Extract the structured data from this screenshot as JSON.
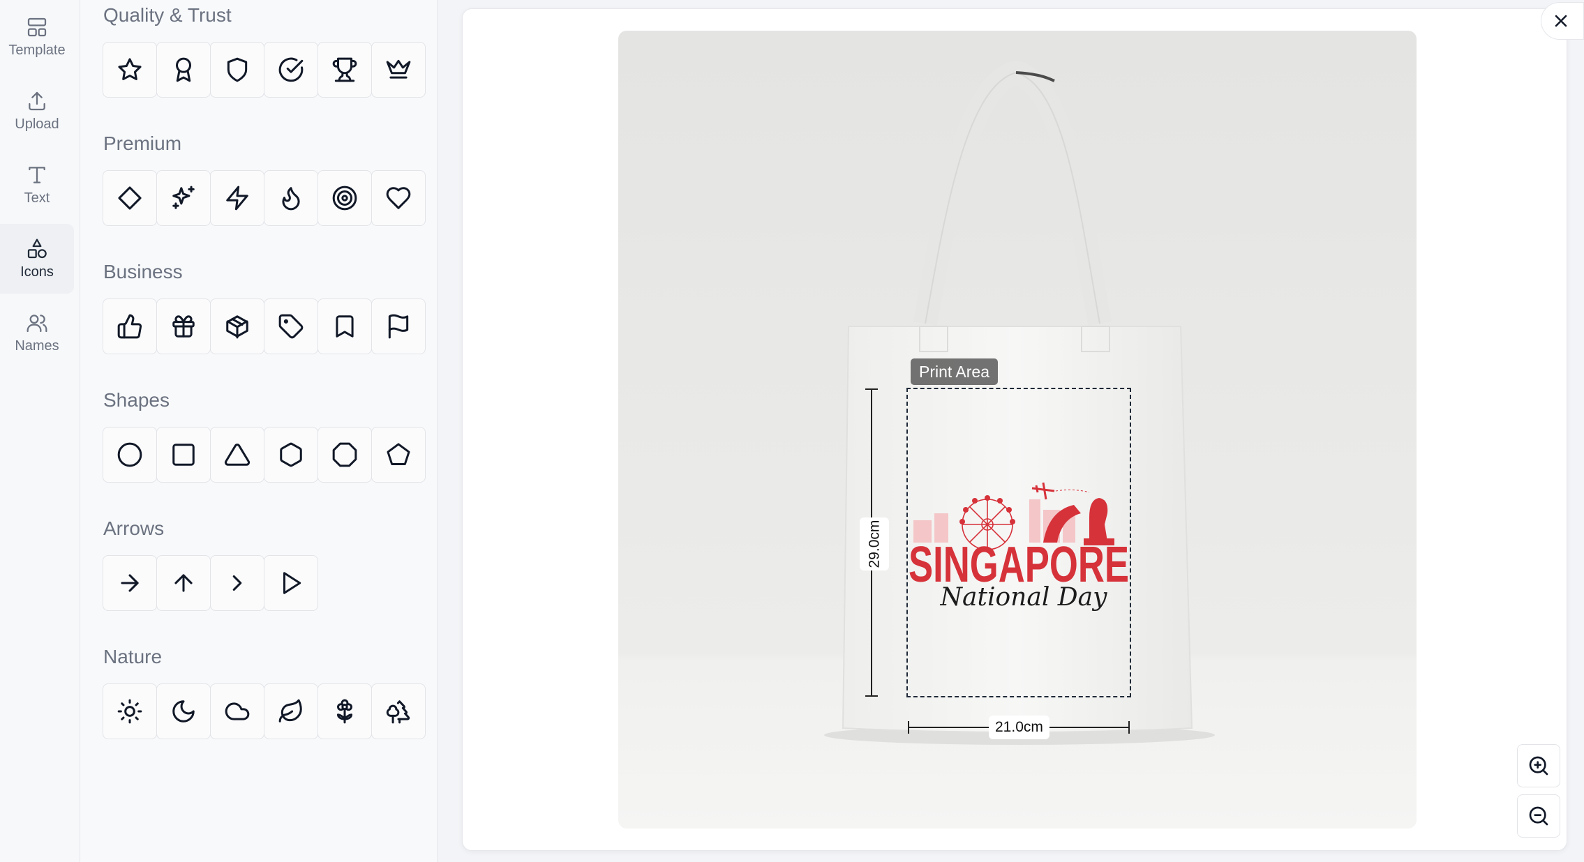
{
  "rail": {
    "items": [
      {
        "label": "Template",
        "icon": "template-icon"
      },
      {
        "label": "Upload",
        "icon": "upload-icon"
      },
      {
        "label": "Text",
        "icon": "text-icon"
      },
      {
        "label": "Icons",
        "icon": "shapes-icon",
        "active": true
      },
      {
        "label": "Names",
        "icon": "users-icon"
      }
    ]
  },
  "panel": {
    "categories": [
      {
        "title": "Quality & Trust",
        "icons": [
          "star-icon",
          "award-icon",
          "shield-icon",
          "check-circle-icon",
          "trophy-icon",
          "crown-icon"
        ]
      },
      {
        "title": "Premium",
        "icons": [
          "diamond-icon",
          "sparkles-icon",
          "zap-icon",
          "flame-icon",
          "target-icon",
          "heart-icon"
        ]
      },
      {
        "title": "Business",
        "icons": [
          "thumbs-up-icon",
          "gift-icon",
          "box-icon",
          "tag-icon",
          "bookmark-icon",
          "flag-icon"
        ]
      },
      {
        "title": "Shapes",
        "icons": [
          "circle-icon",
          "square-icon",
          "triangle-icon",
          "hexagon-icon",
          "octagon-icon",
          "pentagon-icon"
        ]
      },
      {
        "title": "Arrows",
        "icons": [
          "arrow-right-icon",
          "arrow-up-icon",
          "chevron-right-icon",
          "play-icon"
        ]
      },
      {
        "title": "Nature",
        "icons": [
          "sun-icon",
          "moon-icon",
          "cloud-icon",
          "leaf-icon",
          "flower-icon",
          "trees-icon"
        ]
      }
    ]
  },
  "preview": {
    "print_area_label": "Print Area",
    "width_label": "21.0cm",
    "height_label": "29.0cm",
    "design_title": "SINGAPORE",
    "design_subtitle": "National Day",
    "brand_color": "#d6323a"
  },
  "controls": {
    "close": "close-icon",
    "zoom_in": "zoom-in-icon",
    "zoom_out": "zoom-out-icon"
  }
}
